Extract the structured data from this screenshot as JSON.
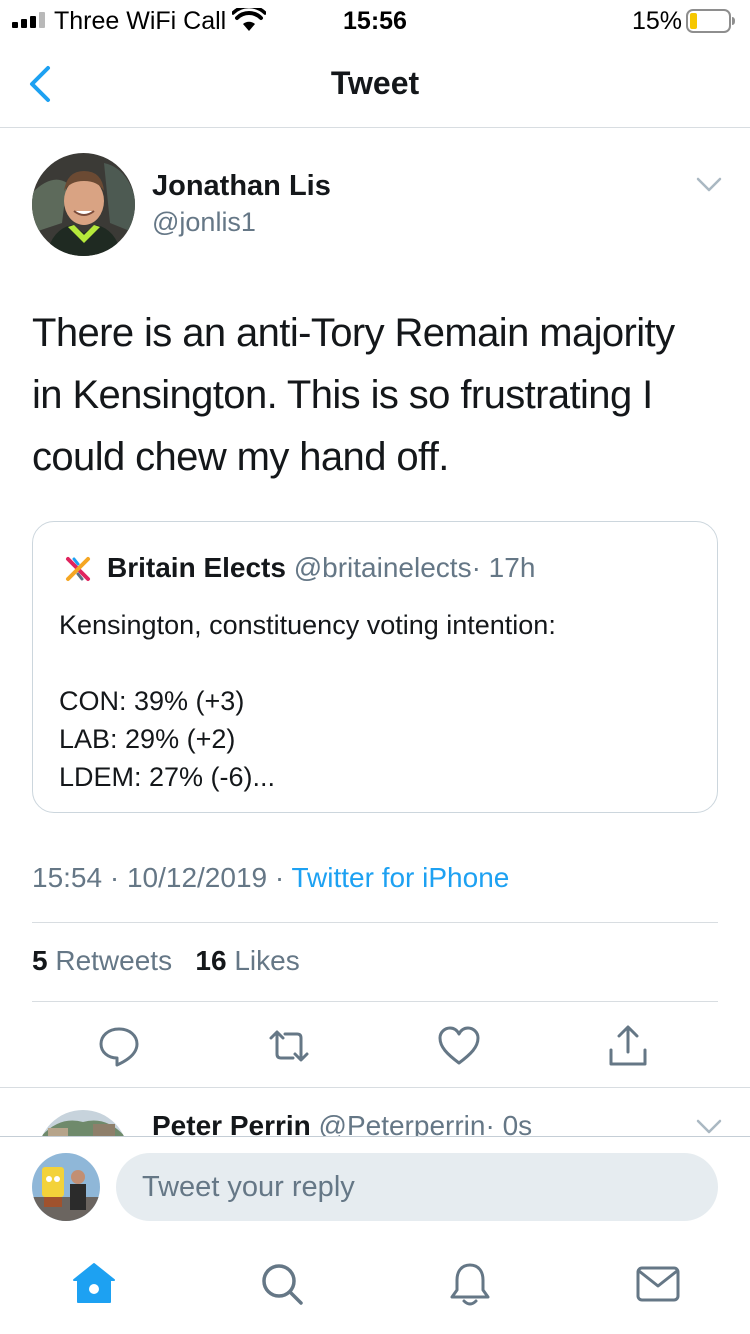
{
  "status_bar": {
    "carrier": "Three WiFi Call",
    "time": "15:56",
    "battery": "15%"
  },
  "nav": {
    "title": "Tweet",
    "back_icon": "chevron-left-icon"
  },
  "tweet": {
    "author_name": "Jonathan Lis",
    "author_handle": "@jonlis1",
    "text_lines": [
      "There is an anti-Tory Remain majority",
      "in Kensington. This is so frustrating I",
      "could chew my hand off."
    ],
    "quote": {
      "name": "Britain Elects",
      "handle": "@britainelects",
      "time": "· 17h",
      "lines": [
        "Kensington, constituency voting intention:",
        "",
        "CON: 39% (+3)",
        "LAB: 29% (+2)",
        "LDEM: 27% (-6)..."
      ]
    },
    "timestamp": "15:54 · 10/12/2019 · ",
    "source": "Twitter for iPhone",
    "retweets_count": "5",
    "retweets_label": "Retweets",
    "likes_count": "16",
    "likes_label": "Likes"
  },
  "actions": {
    "reply_icon": "reply-icon",
    "retweet_icon": "retweet-icon",
    "like_icon": "heart-icon",
    "share_icon": "share-icon"
  },
  "reply_preview": {
    "name": "Peter Perrin",
    "handle": "@Peterperrin",
    "time": "· 0s"
  },
  "composer": {
    "placeholder": "Tweet your reply"
  },
  "colors": {
    "accent": "#1da1f2",
    "text_primary": "#14171a",
    "text_secondary": "#657786",
    "battery_low": "#f6c700"
  },
  "tabs": [
    "home-icon",
    "search-icon",
    "notifications-icon",
    "messages-icon"
  ]
}
